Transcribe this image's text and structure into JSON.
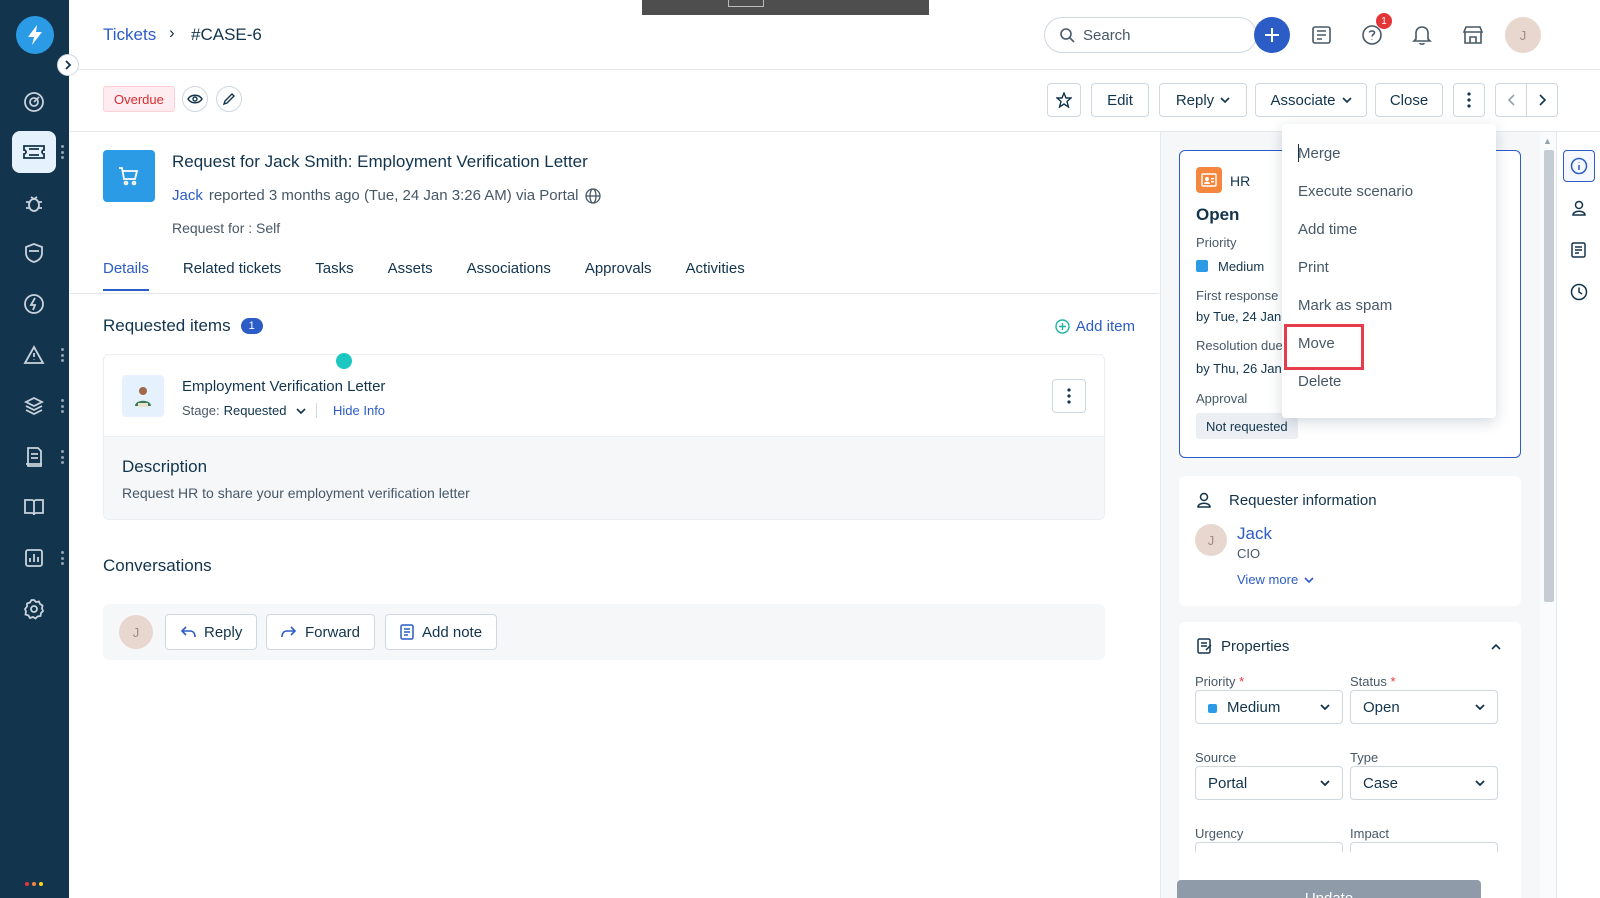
{
  "breadcrumb": {
    "parent": "Tickets",
    "separator": "›",
    "current": "#CASE-6"
  },
  "search": {
    "placeholder": "Search"
  },
  "header": {
    "help_badge": "1",
    "user_initial": "J"
  },
  "toolbar": {
    "overdue": "Overdue",
    "edit": "Edit",
    "reply": "Reply",
    "associate": "Associate",
    "close": "Close"
  },
  "ticket": {
    "title": "Request for Jack Smith: Employment Verification Letter",
    "reporter": "Jack",
    "reported_text": "reported 3 months ago (Tue, 24 Jan 3:26 AM) via Portal",
    "request_for_label": "Request for :",
    "request_for_value": "Self"
  },
  "tabs": [
    "Details",
    "Related tickets",
    "Tasks",
    "Assets",
    "Associations",
    "Approvals",
    "Activities"
  ],
  "requested_items": {
    "title": "Requested items",
    "count": "1",
    "add_item": "Add item",
    "item": {
      "name": "Employment Verification Letter",
      "stage_label": "Stage:",
      "stage_value": "Requested",
      "hide_info": "Hide Info"
    },
    "description_title": "Description",
    "description_text": "Request HR to share your employment verification letter"
  },
  "conversations": {
    "title": "Conversations",
    "avatar": "J",
    "reply": "Reply",
    "forward": "Forward",
    "add_note": "Add note"
  },
  "status_card": {
    "department": "HR",
    "status": "Open",
    "priority_label": "Priority",
    "priority_value": "Medium",
    "first_response_label": "First response d",
    "first_response_value": "by Tue, 24 Jan",
    "resolution_label": "Resolution due",
    "resolution_value": "by Thu, 26 Jan",
    "approval_label": "Approval",
    "approval_value": "Not requested"
  },
  "requester": {
    "title": "Requester information",
    "avatar": "J",
    "name": "Jack",
    "role": "CIO",
    "view_more": "View more"
  },
  "properties": {
    "title": "Properties",
    "priority_label": "Priority",
    "priority_value": "Medium",
    "status_label": "Status",
    "status_value": "Open",
    "source_label": "Source",
    "source_value": "Portal",
    "type_label": "Type",
    "type_value": "Case",
    "urgency_label": "Urgency",
    "impact_label": "Impact",
    "required_mark": "*",
    "update": "Update"
  },
  "more_menu": [
    "Merge",
    "Execute scenario",
    "Add time",
    "Print",
    "Mark as spam",
    "Move",
    "Delete"
  ],
  "colors": {
    "sidebar": "#12344d",
    "accent": "#2c5cc5",
    "highlight": "#e53e4a",
    "teal": "#1cc7c1"
  }
}
